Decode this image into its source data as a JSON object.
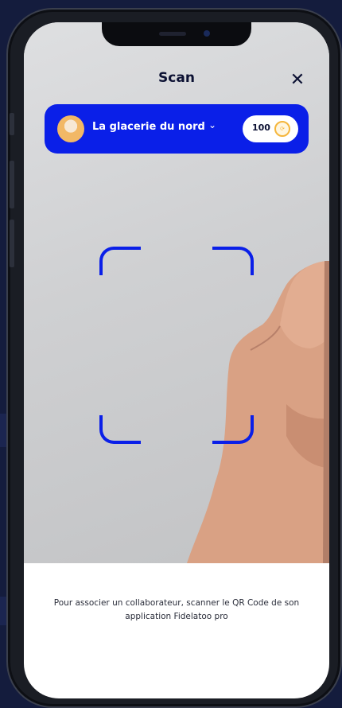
{
  "header": {
    "title": "Scan",
    "close_label": "✕"
  },
  "store": {
    "name": "La glacerie du nord",
    "chevron": "⌄",
    "points": "100",
    "coin_icon": "coin-icon"
  },
  "footer": {
    "instruction": "Pour associer un collaborateur, scanner le QR Code de son application Fidelatoo pro"
  },
  "colors": {
    "accent": "#0a1fe8",
    "background": "#141c3d",
    "text_dark": "#0c1133",
    "coin": "#f5b63c"
  }
}
